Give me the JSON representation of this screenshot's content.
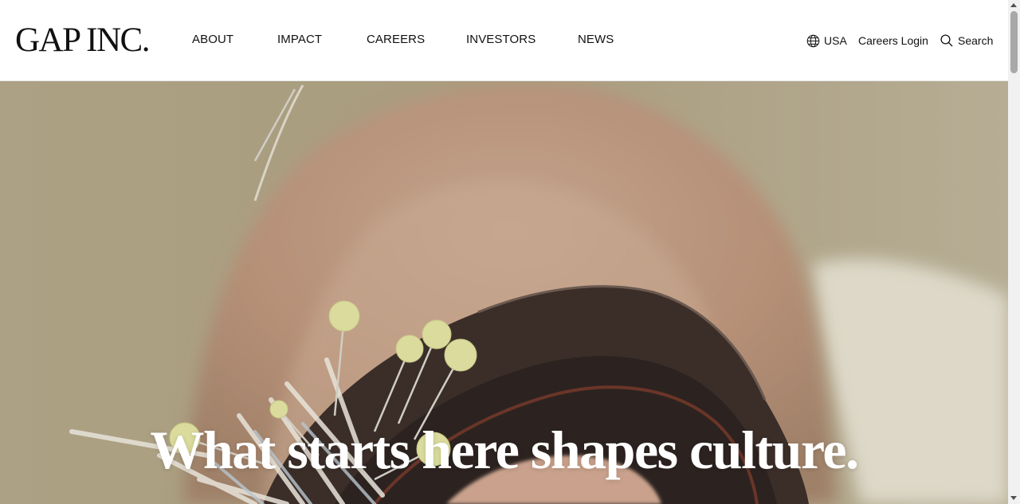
{
  "header": {
    "logo": "GAP INC.",
    "nav": [
      {
        "label": "ABOUT"
      },
      {
        "label": "IMPACT"
      },
      {
        "label": "CAREERS"
      },
      {
        "label": "INVESTORS"
      },
      {
        "label": "NEWS"
      }
    ],
    "utility": {
      "region_label": "USA",
      "region_icon": "globe-icon",
      "login_label": "Careers Login",
      "search_label": "Search",
      "search_icon": "search-icon"
    }
  },
  "hero": {
    "headline": "What starts here shapes culture.",
    "image": "pincushion-and-denim-photo"
  },
  "colors": {
    "text": "#111111",
    "hero_text": "#ffffff",
    "header_bg": "#ffffff"
  }
}
